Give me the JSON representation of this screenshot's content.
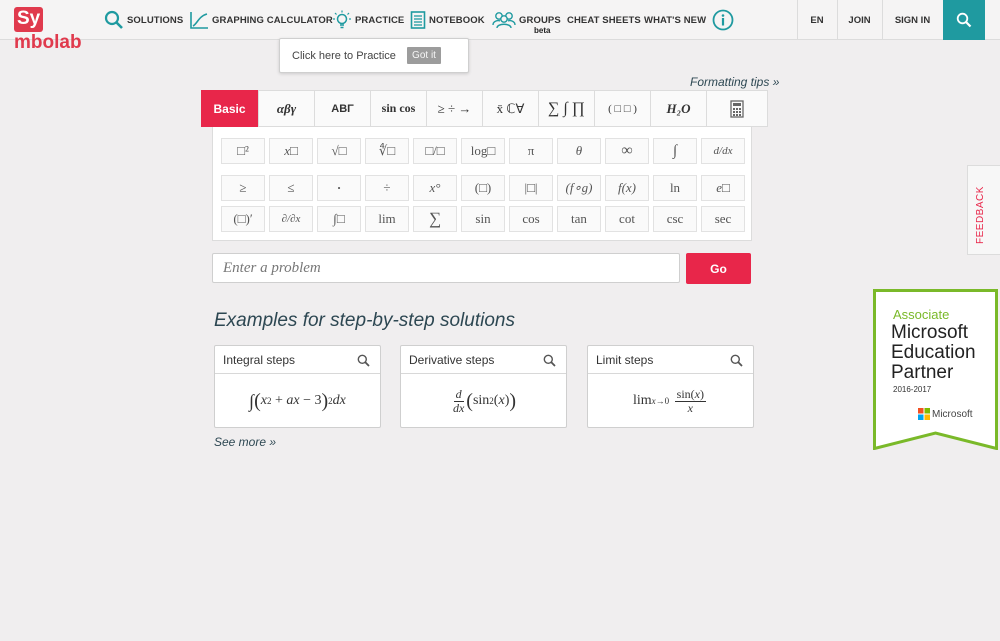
{
  "brand": {
    "logo_highlight": "Sy",
    "logo_rest": "mbolab"
  },
  "nav": {
    "solutions": "SOLUTIONS",
    "graphing": "GRAPHING CALCULATOR",
    "practice": "PRACTICE",
    "notebook": "NOTEBOOK",
    "groups": "GROUPS",
    "groups_badge": "beta",
    "cheat_sheets": "CHEAT SHEETS",
    "whats_new": "WHAT'S NEW",
    "lang": "EN",
    "join": "JOIN",
    "sign_in": "SIGN IN"
  },
  "tooltip": {
    "text": "Click here to Practice",
    "button": "Got it"
  },
  "formatting_tips": "Formatting tips »",
  "keypad": {
    "tabs": [
      "Basic",
      "αβγ",
      "ΑΒΓ",
      "sin cos",
      "≥ ÷ →",
      "x̄ ℂ∀",
      "∑ ∫ ∏",
      "( □ □ )",
      "H₂O",
      "calculator-icon"
    ],
    "row1": [
      "□²",
      "x□",
      "√□",
      "∜□",
      "□/□",
      "log□",
      "π",
      "θ",
      "∞",
      "∫",
      "d/dx"
    ],
    "row2": [
      "≥",
      "≤",
      "·",
      "÷",
      "x°",
      "(□)",
      "|□|",
      "(f∘g)",
      "f(x)",
      "ln",
      "e□"
    ],
    "row3": [
      "(□)′",
      "∂/∂x",
      "∫□",
      "lim",
      "∑",
      "sin",
      "cos",
      "tan",
      "cot",
      "csc",
      "sec"
    ]
  },
  "input": {
    "placeholder": "Enter a problem",
    "go": "Go"
  },
  "examples": {
    "title": "Examples for step-by-step solutions",
    "cards": [
      {
        "title": "Integral steps"
      },
      {
        "title": "Derivative steps"
      },
      {
        "title": "Limit steps"
      }
    ],
    "see_more": "See more »"
  },
  "feedback": "FEEDBACK",
  "badge": {
    "line1": "Associate",
    "line2": "Microsoft",
    "line3": "Education",
    "line4": "Partner",
    "years": "2016-2017",
    "ms": "Microsoft"
  },
  "colors": {
    "accent": "#e8264a",
    "teal": "#1f9aa0",
    "green": "#7ab929"
  }
}
